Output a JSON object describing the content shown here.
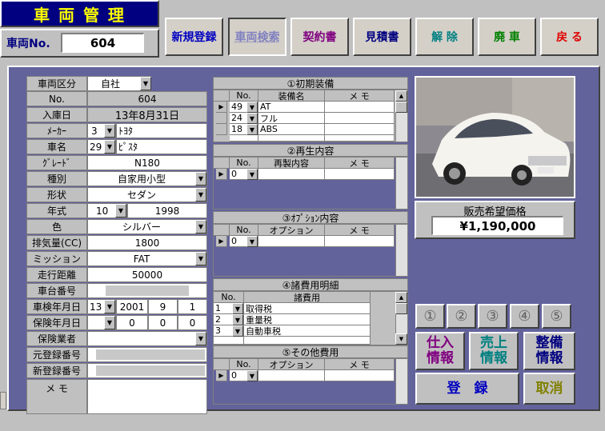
{
  "header": {
    "app_title": "車 両 管 理",
    "vehicle_no_label": "車両No.",
    "vehicle_no_value": "604"
  },
  "toolbar": {
    "buttons": [
      {
        "label": "新規登録",
        "color": "#0000c0"
      },
      {
        "label": "車両検索",
        "color": "#8080c0"
      },
      {
        "label": "契約書",
        "color": "#800080"
      },
      {
        "label": "見積書",
        "color": "#000080"
      },
      {
        "label": "解 除",
        "color": "#008080"
      },
      {
        "label": "廃 車",
        "color": "#008000"
      },
      {
        "label": "戻 る",
        "color": "#e00000"
      }
    ]
  },
  "form": {
    "kubun": {
      "label": "車両区分",
      "value": "自社"
    },
    "no": {
      "label": "No.",
      "value": "604"
    },
    "nyuko": {
      "label": "入庫日",
      "value": "13年8月31日"
    },
    "maker": {
      "label": "ﾒｰｶｰ",
      "code": "3",
      "value": "ﾄﾖﾀ"
    },
    "car_name": {
      "label": "車名",
      "code": "29",
      "value": "ﾋﾟｽﾀ"
    },
    "grade": {
      "label": "ｸﾞﾚｰﾄﾞ",
      "value": "N180"
    },
    "shubetsu": {
      "label": "種別",
      "value": "自家用小型"
    },
    "keijo": {
      "label": "形状",
      "value": "セダン"
    },
    "nenshiki": {
      "label": "年式",
      "month": "10",
      "year": "1998"
    },
    "color": {
      "label": "色",
      "value": "シルバー"
    },
    "displacement": {
      "label": "排気量(CC)",
      "value": "1800"
    },
    "mission": {
      "label": "ミッション",
      "value": "FAT"
    },
    "mileage": {
      "label": "走行距離",
      "value": "50000"
    },
    "chassis": {
      "label": "車台番号",
      "value": ""
    },
    "shaken": {
      "label": "車検年月日",
      "era": "13",
      "year": "2001",
      "month": "9",
      "day": "1"
    },
    "hoken": {
      "label": "保険年月日",
      "era": "",
      "year": "0",
      "month": "0",
      "day": "0"
    },
    "insurer": {
      "label": "保険業者",
      "value": ""
    },
    "old_reg": {
      "label": "元登録番号",
      "value": ""
    },
    "new_reg": {
      "label": "新登録番号",
      "value": ""
    },
    "memo": {
      "label": "メ モ",
      "value": ""
    }
  },
  "sections": {
    "initial": {
      "title": "①初期装備",
      "col_no": "No.",
      "col_name": "装備名",
      "col_memo": "メ モ",
      "rows": [
        {
          "no": "49",
          "name": "AT"
        },
        {
          "no": "24",
          "name": "フル"
        },
        {
          "no": "18",
          "name": "ABS"
        },
        {
          "no": "",
          "name": ""
        }
      ]
    },
    "recon": {
      "title": "②再生内容",
      "col_no": "No.",
      "col_name": "再製内容",
      "col_memo": "メ モ",
      "row_no": "0"
    },
    "option": {
      "title": "③ｵﾌﾟｼｮﾝ内容",
      "col_no": "No.",
      "col_name": "オプション",
      "col_memo": "メ モ",
      "row_no": "0"
    },
    "expenses": {
      "title": "④諸費用明細",
      "col_no": "No.",
      "col_name": "諸費用",
      "rows": [
        {
          "no": "1",
          "name": "取得税"
        },
        {
          "no": "2",
          "name": "重量税"
        },
        {
          "no": "3",
          "name": "自動車税"
        },
        {
          "no": "",
          "name": ""
        }
      ]
    },
    "other": {
      "title": "⑤その他費用",
      "col_no": "No.",
      "col_name": "オプション",
      "col_memo": "メ モ",
      "row_no": "0"
    }
  },
  "price": {
    "label": "販売希望価格",
    "value": "¥1,190,000"
  },
  "page_buttons": [
    "①",
    "②",
    "③",
    "④",
    "⑤"
  ],
  "info_buttons": [
    {
      "line1": "仕入",
      "line2": "情報",
      "color": "#800080"
    },
    {
      "line1": "売上",
      "line2": "情報",
      "color": "#008080"
    },
    {
      "line1": "整備",
      "line2": "情報",
      "color": "#000080"
    }
  ],
  "actions": {
    "register": {
      "label": "登　録",
      "color": "#0000c0"
    },
    "cancel": {
      "label": "取消",
      "color": "#808000"
    }
  },
  "colors": {
    "panel": "#63639c",
    "title_bg": "#000080",
    "title_fg": "#ffff00"
  }
}
